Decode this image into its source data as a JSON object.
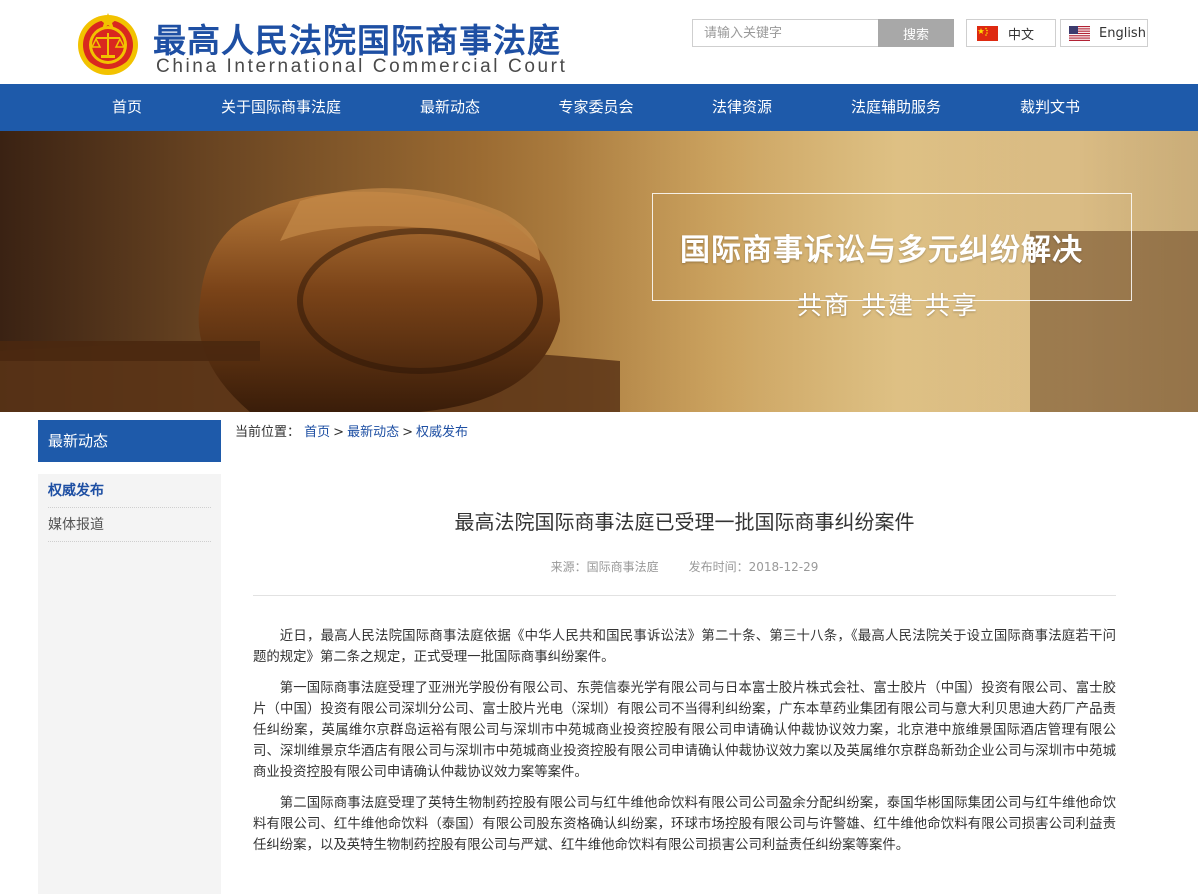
{
  "header": {
    "logo_cn": "最高人民法院国际商事法庭",
    "logo_en": "China International Commercial Court",
    "search_placeholder": "请输入关键字",
    "search_button": "搜索",
    "lang_cn": "中文",
    "lang_en": "English"
  },
  "nav": {
    "items": [
      "首页",
      "关于国际商事法庭",
      "最新动态",
      "专家委员会",
      "法律资源",
      "法庭辅助服务",
      "裁判文书"
    ]
  },
  "banner": {
    "title": "国际商事诉讼与多元纠纷解决",
    "subtitle": "共商 共建 共享"
  },
  "sidebar": {
    "heading": "最新动态",
    "items": [
      "权威发布",
      "媒体报道"
    ],
    "active_index": 0
  },
  "breadcrumb": {
    "prefix": "当前位置：",
    "items": [
      "首页",
      "最新动态",
      "权威发布"
    ],
    "separator": ">"
  },
  "article": {
    "title": "最高法院国际商事法庭已受理一批国际商事纠纷案件",
    "source_label": "来源：",
    "source": "国际商事法庭",
    "time_label": "发布时间：",
    "time": "2018-12-29",
    "paragraphs": [
      "近日，最高人民法院国际商事法庭依据《中华人民共和国民事诉讼法》第二十条、第三十八条，《最高人民法院关于设立国际商事法庭若干问题的规定》第二条之规定，正式受理一批国际商事纠纷案件。",
      "第一国际商事法庭受理了亚洲光学股份有限公司、东莞信泰光学有限公司与日本富士胶片株式会社、富士胶片（中国）投资有限公司、富士胶片（中国）投资有限公司深圳分公司、富士胶片光电（深圳）有限公司不当得利纠纷案，广东本草药业集团有限公司与意大利贝思迪大药厂产品责任纠纷案，英属维尔京群岛运裕有限公司与深圳市中苑城商业投资控股有限公司申请确认仲裁协议效力案，北京港中旅维景国际酒店管理有限公司、深圳维景京华酒店有限公司与深圳市中苑城商业投资控股有限公司申请确认仲裁协议效力案以及英属维尔京群岛新劲企业公司与深圳市中苑城商业投资控股有限公司申请确认仲裁协议效力案等案件。",
      "第二国际商事法庭受理了英特生物制药控股有限公司与红牛维他命饮料有限公司公司盈余分配纠纷案，泰国华彬国际集团公司与红牛维他命饮料有限公司、红牛维他命饮料（泰国）有限公司股东资格确认纠纷案，环球市场控股有限公司与许警雄、红牛维他命饮料有限公司损害公司利益责任纠纷案，以及英特生物制药控股有限公司与严斌、红牛维他命饮料有限公司损害公司利益责任纠纷案等案件。"
    ]
  },
  "colors": {
    "brand_blue": "#1e5aaa",
    "logo_text_blue": "#1e4fa3",
    "emblem_red": "#d9281f",
    "emblem_gold": "#f2c200"
  },
  "icons": [
    "court-emblem-icon",
    "china-flag-icon",
    "us-flag-icon"
  ]
}
